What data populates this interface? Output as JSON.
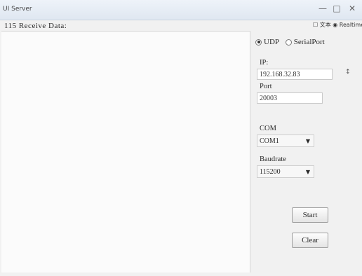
{
  "window": {
    "title": "UI Server",
    "controls": {
      "minimize": "—",
      "maximize": "□",
      "close": "✕"
    }
  },
  "receive": {
    "label": "115 Receive Data:",
    "content": ""
  },
  "options": {
    "hex_label": "☐ 文本",
    "realtime_label": "◉ Realtime"
  },
  "mode": {
    "udp_label": "UDP",
    "serial_label": "SerialPort",
    "selected": "UDP"
  },
  "network": {
    "ip_label": "IP:",
    "ip_value": "192.168.32.83",
    "port_label": "Port",
    "port_value": "20003"
  },
  "serial": {
    "com_label": "COM",
    "com_value": "COM1",
    "baud_label": "Baudrate",
    "baud_value": "115200"
  },
  "buttons": {
    "start_label": "Start",
    "clear_label": "Clear"
  },
  "icons": {
    "dropdown": "caret-down-icon",
    "spin": "spinner-arrows-icon"
  }
}
